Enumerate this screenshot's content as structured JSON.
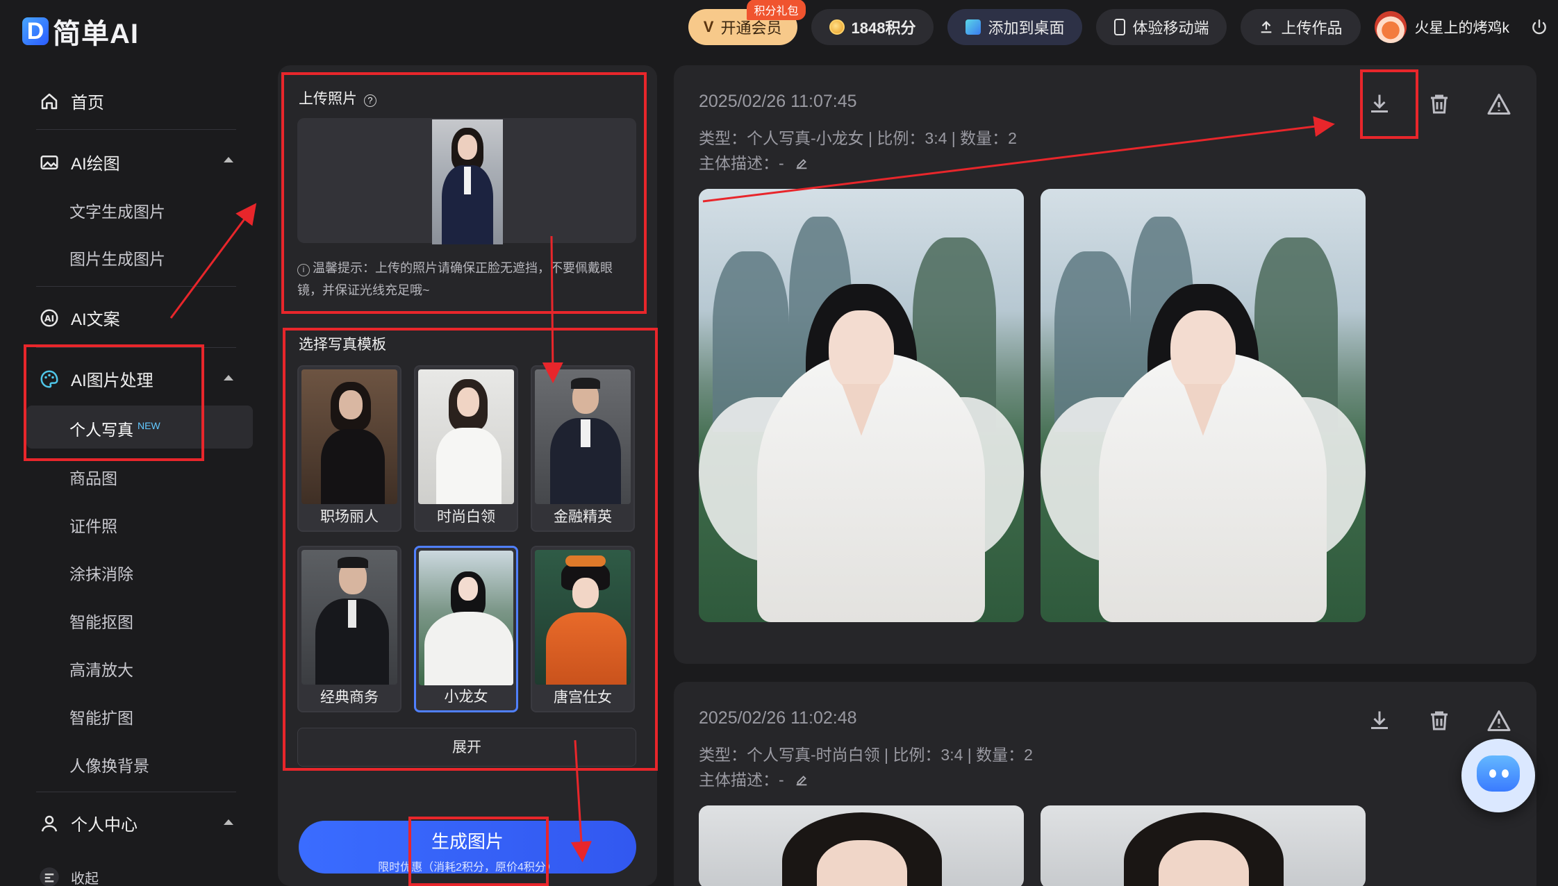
{
  "header": {
    "logo_letter": "D",
    "logo_text": "简单AI",
    "vip_label": "开通会员",
    "vip_badge": "积分礼包",
    "points": "1848积分",
    "add_desktop": "添加到桌面",
    "mobile": "体验移动端",
    "upload_work": "上传作品",
    "username": "火星上的烤鸡k"
  },
  "sidebar": {
    "home": "首页",
    "ai_draw": "AI绘图",
    "text_to_image": "文字生成图片",
    "image_to_image": "图片生成图片",
    "ai_copy": "AI文案",
    "ai_image": "AI图片处理",
    "portrait": "个人写真",
    "portrait_tag": "NEW",
    "product": "商品图",
    "id_photo": "证件照",
    "erase": "涂抹消除",
    "cutout": "智能抠图",
    "upscale": "高清放大",
    "outpaint": "智能扩图",
    "bg_swap": "人像换背景",
    "personal_center": "个人中心",
    "collapse": "收起"
  },
  "panel": {
    "upload_title": "上传照片",
    "tip": "温馨提示：上传的照片请确保正脸无遮挡，不要佩戴眼镜，并保证光线充足哦~",
    "template_title": "选择写真模板",
    "templates": [
      "职场丽人",
      "时尚白领",
      "金融精英",
      "经典商务",
      "小龙女",
      "唐宫仕女"
    ],
    "selected_template": "小龙女",
    "expand": "展开",
    "generate": "生成图片",
    "generate_sub": "限时优惠（消耗2积分，原价4积分）"
  },
  "results": [
    {
      "time": "2025/02/26 11:07:45",
      "type_line": "类型：个人写真-小龙女 | 比例：3:4 | 数量：2",
      "subject_line": "主体描述：-"
    },
    {
      "time": "2025/02/26 11:02:48",
      "type_line": "类型：个人写真-时尚白领 | 比例：3:4 | 数量：2",
      "subject_line": "主体描述：-"
    }
  ],
  "colors": {
    "accent": "#3a6cff",
    "annotation": "#e8262b",
    "vip": "#f7c98a"
  }
}
